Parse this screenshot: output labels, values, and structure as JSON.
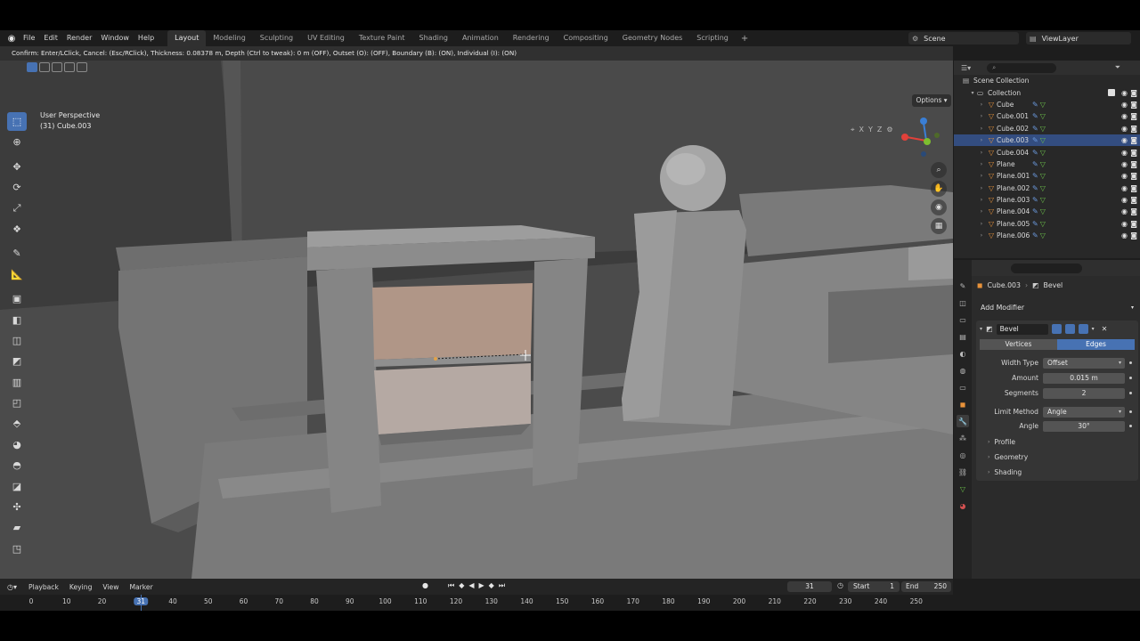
{
  "menubar": {
    "logo_icon": "blender-logo-icon",
    "menus": [
      "File",
      "Edit",
      "Render",
      "Window",
      "Help"
    ],
    "workspaces": [
      "Layout",
      "Modeling",
      "Sculpting",
      "UV Editing",
      "Texture Paint",
      "Shading",
      "Animation",
      "Rendering",
      "Compositing",
      "Geometry Nodes",
      "Scripting"
    ],
    "active_workspace": "Layout",
    "add_workspace": "+",
    "scene": "Scene",
    "view_layer": "ViewLayer"
  },
  "status": {
    "operator_text": "Confirm: Enter/LClick, Cancel: (Esc/RClick), Thickness: 0.08378 m, Depth (Ctrl to tweak): 0 m (OFF), Outset (O): (OFF), Boundary (B): (ON), Individual (I): (ON)"
  },
  "viewport": {
    "view_name": "User Perspective",
    "object_info": "(31) Cube.003",
    "options_label": "Options",
    "axis_labels": [
      "X",
      "Y",
      "Z"
    ],
    "gizmo_axes": {
      "x_color": "#e0413a",
      "y_color": "#7dbd2f",
      "z_color": "#3a7fd6"
    },
    "tools": [
      "select-box-icon",
      "cursor-icon",
      "move-icon",
      "rotate-icon",
      "scale-icon",
      "transform-icon",
      "annotate-icon",
      "measure-icon",
      "add-cube-icon",
      "extrude-icon",
      "inset-icon",
      "bevel-icon",
      "loop-cut-icon",
      "knife-icon",
      "poly-build-icon",
      "spin-icon",
      "smooth-icon",
      "edge-slide-icon",
      "shrink-fatten-icon",
      "shear-icon",
      "rip-icon"
    ],
    "nav_buttons": [
      "zoom-icon",
      "pan-hand-icon",
      "camera-icon",
      "grid-icon"
    ]
  },
  "outliner": {
    "root": "Scene Collection",
    "collection": "Collection",
    "items": [
      {
        "name": "Cube",
        "selected": false
      },
      {
        "name": "Cube.001",
        "selected": false
      },
      {
        "name": "Cube.002",
        "selected": false
      },
      {
        "name": "Cube.003",
        "selected": true
      },
      {
        "name": "Cube.004",
        "selected": false
      },
      {
        "name": "Plane",
        "selected": false
      },
      {
        "name": "Plane.001",
        "selected": false
      },
      {
        "name": "Plane.002",
        "selected": false
      },
      {
        "name": "Plane.003",
        "selected": false
      },
      {
        "name": "Plane.004",
        "selected": false
      },
      {
        "name": "Plane.005",
        "selected": false
      },
      {
        "name": "Plane.006",
        "selected": false
      }
    ]
  },
  "properties": {
    "object": "Cube.003",
    "modifier_crumb": "Bevel",
    "add_modifier": "Add Modifier",
    "modifier": {
      "name": "Bevel",
      "affect_options": [
        "Vertices",
        "Edges"
      ],
      "affect_active": "Edges",
      "fields": [
        {
          "label": "Width Type",
          "value": "Offset",
          "dropdown": true
        },
        {
          "label": "Amount",
          "value": "0.015 m",
          "dropdown": false
        },
        {
          "label": "Segments",
          "value": "2",
          "dropdown": false
        },
        {
          "label": "Limit Method",
          "value": "Angle",
          "dropdown": true
        },
        {
          "label": "Angle",
          "value": "30°",
          "dropdown": false
        }
      ],
      "subpanels": [
        "Profile",
        "Geometry",
        "Shading"
      ]
    }
  },
  "timeline": {
    "menus": [
      "Playback",
      "Keying",
      "View",
      "Marker"
    ],
    "current_frame": "31",
    "start_label": "Start",
    "start": "1",
    "end_label": "End",
    "end": "250",
    "ruler_ticks": [
      "0",
      "10",
      "20",
      "31",
      "40",
      "50",
      "60",
      "70",
      "80",
      "90",
      "100",
      "110",
      "120",
      "130",
      "140",
      "150",
      "160",
      "170",
      "180",
      "190",
      "200",
      "210",
      "220",
      "230",
      "240",
      "250"
    ]
  }
}
